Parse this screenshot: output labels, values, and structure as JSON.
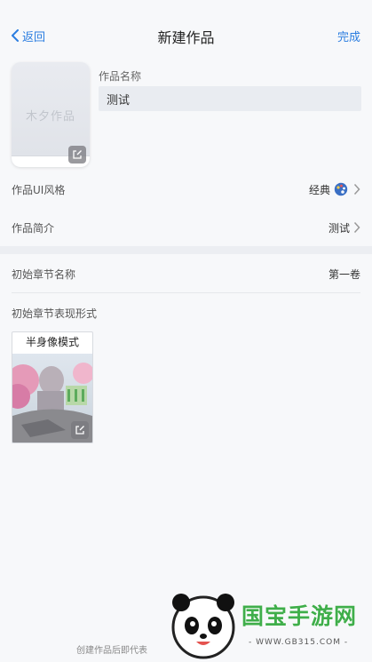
{
  "nav": {
    "back_label": "返回",
    "title": "新建作品",
    "done_label": "完成"
  },
  "cover": {
    "placeholder_text": "木夕作品"
  },
  "work_name": {
    "label": "作品名称",
    "value": "测试"
  },
  "ui_style": {
    "label": "作品UI风格",
    "value": "经典",
    "icon": "palette-icon"
  },
  "intro": {
    "label": "作品简介",
    "value": "测试"
  },
  "chapter_name": {
    "label": "初始章节名称",
    "value": "第一卷"
  },
  "chapter_mode": {
    "label": "初始章节表现形式",
    "card_title": "半身像模式"
  },
  "footer": {
    "text": "创建作品后即代表"
  },
  "watermark": {
    "brand": "国宝手游网",
    "url": "- WWW.GB315.COM -"
  },
  "colors": {
    "accent": "#2b7de0",
    "background": "#f7f8fa",
    "brand_green": "#3fae4a"
  }
}
